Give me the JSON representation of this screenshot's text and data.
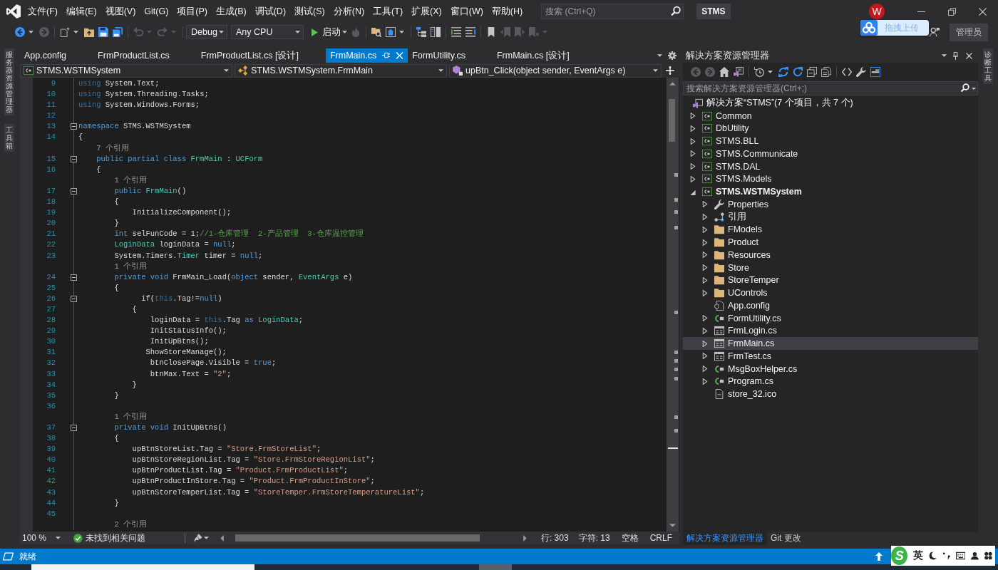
{
  "menu_bar": {
    "items": [
      "文件(F)",
      "编辑(E)",
      "视图(V)",
      "Git(G)",
      "项目(P)",
      "生成(B)",
      "调试(D)",
      "测试(S)",
      "分析(N)",
      "工具(T)",
      "扩展(X)",
      "窗口(W)",
      "帮助(H)"
    ],
    "search": {
      "placeholder": "搜索 (Ctrl+Q)"
    },
    "solution_name": "STMS",
    "account_initial": "W"
  },
  "toolbar": {
    "left_buttons": [
      {
        "kind": "back",
        "disabled": false,
        "dropdown": true
      },
      {
        "kind": "forward",
        "disabled": true,
        "dropdown": false
      },
      {
        "kind": "new",
        "disabled": false,
        "dropdown": true
      },
      {
        "kind": "open",
        "disabled": false,
        "dropdown": false
      },
      {
        "kind": "save",
        "disabled": false,
        "dropdown": false
      },
      {
        "kind": "save-all",
        "disabled": false,
        "dropdown": false
      },
      {
        "kind": "undo",
        "disabled": true,
        "dropdown": true
      },
      {
        "kind": "redo",
        "disabled": true,
        "dropdown": true
      }
    ],
    "configuration": "Debug",
    "platform": "Any CPU",
    "start_label": "启动",
    "right_buttons": [
      {
        "kind": "hot-reload",
        "disabled": true,
        "dropdown": false
      },
      {
        "kind": "find-files",
        "disabled": false,
        "dropdown": false
      },
      {
        "kind": "browser",
        "disabled": false,
        "dropdown": true
      },
      {
        "kind": "hierarchy",
        "disabled": false,
        "dropdown": false
      },
      {
        "kind": "layout",
        "disabled": false,
        "dropdown": false
      },
      {
        "kind": "comment",
        "disabled": false,
        "dropdown": false
      },
      {
        "kind": "uncomment",
        "disabled": false,
        "dropdown": false
      },
      {
        "kind": "bookmark",
        "disabled": false,
        "dropdown": false
      },
      {
        "kind": "bookmark-prev",
        "disabled": true,
        "dropdown": false
      },
      {
        "kind": "bookmark-next",
        "disabled": true,
        "dropdown": false
      },
      {
        "kind": "bookmark-clear",
        "disabled": true,
        "dropdown": true
      }
    ],
    "admin_label": "管理员"
  },
  "upload_widget": {
    "label": "拖拽上传"
  },
  "left_side_tabs": [
    "服务器资源管理器",
    "工具箱"
  ],
  "editor": {
    "tabs": [
      {
        "label": "App.config",
        "selected": false
      },
      {
        "label": "FrmProductList.cs",
        "selected": false
      },
      {
        "label": "FrmProductList.cs [设计]",
        "selected": false
      },
      {
        "label": "FrmMain.cs",
        "selected": true
      },
      {
        "label": "FormUtility.cs",
        "selected": false
      },
      {
        "label": "FrmMain.cs [设计]",
        "selected": false
      }
    ],
    "nav": [
      {
        "kind": "project",
        "label": "STMS.WSTMSystem"
      },
      {
        "kind": "class",
        "label": "STMS.WSTMSystem.FrmMain"
      },
      {
        "kind": "method",
        "label": "upBtn_Click(object sender, EventArgs e)"
      }
    ],
    "lines": [
      {
        "kind": "code",
        "number": "9",
        "collapsible": false,
        "tokens": [
          {
            "kind": "dimmed",
            "text": "using"
          },
          {
            "kind": "plain",
            "text": " System.Text;"
          }
        ]
      },
      {
        "kind": "code",
        "number": "10",
        "collapsible": false,
        "tokens": [
          {
            "kind": "dimmed",
            "text": "using"
          },
          {
            "kind": "plain",
            "text": " System.Threading.Tasks;"
          }
        ]
      },
      {
        "kind": "code",
        "number": "11",
        "collapsible": false,
        "tokens": [
          {
            "kind": "dimmed",
            "text": "using"
          },
          {
            "kind": "plain",
            "text": " System.Windows.Forms;"
          }
        ]
      },
      {
        "kind": "code",
        "number": "12",
        "collapsible": false
      },
      {
        "kind": "code",
        "number": "13",
        "collapsible": true,
        "tokens": [
          {
            "kind": "keyword",
            "text": "namespace"
          },
          {
            "kind": "plain",
            "text": " STMS.WSTMSystem"
          }
        ]
      },
      {
        "kind": "code",
        "number": "14",
        "collapsible": false,
        "tokens": [
          {
            "kind": "plain",
            "text": "{"
          }
        ]
      },
      {
        "kind": "lens",
        "text": "    7 个引用"
      },
      {
        "kind": "code",
        "number": "15",
        "collapsible": true,
        "tokens": [
          {
            "kind": "keyword",
            "text": "    public partial class "
          },
          {
            "kind": "type",
            "text": "FrmMain"
          },
          {
            "kind": "plain",
            "text": " : "
          },
          {
            "kind": "type",
            "text": "UCForm"
          }
        ]
      },
      {
        "kind": "code",
        "number": "16",
        "collapsible": false,
        "tokens": [
          {
            "kind": "plain",
            "text": "    {"
          }
        ]
      },
      {
        "kind": "lens",
        "text": "        1 个引用"
      },
      {
        "kind": "code",
        "number": "17",
        "collapsible": true,
        "tokens": [
          {
            "kind": "keyword",
            "text": "        public "
          },
          {
            "kind": "type",
            "text": "FrmMain"
          },
          {
            "kind": "plain",
            "text": "()"
          }
        ]
      },
      {
        "kind": "code",
        "number": "18",
        "collapsible": false,
        "tokens": [
          {
            "kind": "plain",
            "text": "        {"
          }
        ]
      },
      {
        "kind": "code",
        "number": "19",
        "collapsible": false,
        "tokens": [
          {
            "kind": "plain",
            "text": "            InitializeComponent();"
          }
        ]
      },
      {
        "kind": "code",
        "number": "20",
        "collapsible": false,
        "tokens": [
          {
            "kind": "plain",
            "text": "        }"
          }
        ]
      },
      {
        "kind": "code",
        "number": "21",
        "collapsible": false,
        "tokens": [
          {
            "kind": "keyword",
            "text": "        int"
          },
          {
            "kind": "plain",
            "text": " selFunCode = 1;"
          },
          {
            "kind": "comment",
            "text": "//1-仓库管理  2-产品管理  3-仓库温控管理"
          }
        ]
      },
      {
        "kind": "code",
        "number": "22",
        "collapsible": false,
        "tokens": [
          {
            "kind": "type",
            "text": "        LoginData"
          },
          {
            "kind": "plain",
            "text": " loginData = "
          },
          {
            "kind": "keyword",
            "text": "null"
          },
          {
            "kind": "plain",
            "text": ";"
          }
        ]
      },
      {
        "kind": "code",
        "number": "23",
        "collapsible": false,
        "tokens": [
          {
            "kind": "plain",
            "text": "        System.Timers."
          },
          {
            "kind": "type",
            "text": "Timer"
          },
          {
            "kind": "plain",
            "text": " timer = "
          },
          {
            "kind": "keyword",
            "text": "null"
          },
          {
            "kind": "plain",
            "text": ";"
          }
        ]
      },
      {
        "kind": "lens",
        "text": "        1 个引用"
      },
      {
        "kind": "code",
        "number": "24",
        "collapsible": true,
        "tokens": [
          {
            "kind": "keyword",
            "text": "        private void"
          },
          {
            "kind": "plain",
            "text": " FrmMain_Load("
          },
          {
            "kind": "keyword",
            "text": "object"
          },
          {
            "kind": "plain",
            "text": " sender, "
          },
          {
            "kind": "type",
            "text": "EventArgs"
          },
          {
            "kind": "plain",
            "text": " e)"
          }
        ]
      },
      {
        "kind": "code",
        "number": "25",
        "collapsible": false,
        "tokens": [
          {
            "kind": "plain",
            "text": "        {"
          }
        ]
      },
      {
        "kind": "code",
        "number": "26",
        "collapsible": true,
        "tokens": [
          {
            "kind": "plain",
            "text": "              if("
          },
          {
            "kind": "dimmed",
            "text": "this"
          },
          {
            "kind": "plain",
            "text": ".Tag!="
          },
          {
            "kind": "keyword",
            "text": "null"
          },
          {
            "kind": "plain",
            "text": ")"
          }
        ]
      },
      {
        "kind": "code",
        "number": "27",
        "collapsible": false,
        "tokens": [
          {
            "kind": "plain",
            "text": "            {"
          }
        ]
      },
      {
        "kind": "code",
        "number": "28",
        "collapsible": false,
        "tokens": [
          {
            "kind": "plain",
            "text": "                loginData = "
          },
          {
            "kind": "dimmed",
            "text": "this"
          },
          {
            "kind": "plain",
            "text": ".Tag "
          },
          {
            "kind": "keyword",
            "text": "as "
          },
          {
            "kind": "type",
            "text": "LoginData"
          },
          {
            "kind": "plain",
            "text": ";"
          }
        ]
      },
      {
        "kind": "code",
        "number": "29",
        "collapsible": false,
        "tokens": [
          {
            "kind": "plain",
            "text": "                InitStatusInfo();"
          }
        ]
      },
      {
        "kind": "code",
        "number": "30",
        "collapsible": false,
        "tokens": [
          {
            "kind": "plain",
            "text": "                InitUpBtns();"
          }
        ]
      },
      {
        "kind": "code",
        "number": "31",
        "collapsible": false,
        "tokens": [
          {
            "kind": "plain",
            "text": "               ShowStoreManage();"
          }
        ]
      },
      {
        "kind": "code",
        "number": "32",
        "collapsible": false,
        "tokens": [
          {
            "kind": "plain",
            "text": "                btnClosePage.Visible = "
          },
          {
            "kind": "keyword",
            "text": "true"
          },
          {
            "kind": "plain",
            "text": ";"
          }
        ]
      },
      {
        "kind": "code",
        "number": "33",
        "collapsible": false,
        "tokens": [
          {
            "kind": "plain",
            "text": "                btnMax.Text = "
          },
          {
            "kind": "string",
            "text": "\"2\""
          },
          {
            "kind": "plain",
            "text": ";"
          }
        ]
      },
      {
        "kind": "code",
        "number": "34",
        "collapsible": false,
        "tokens": [
          {
            "kind": "plain",
            "text": "            }"
          }
        ]
      },
      {
        "kind": "code",
        "number": "35",
        "collapsible": false,
        "tokens": [
          {
            "kind": "plain",
            "text": "        }"
          }
        ]
      },
      {
        "kind": "code",
        "number": "36",
        "collapsible": false
      },
      {
        "kind": "lens",
        "text": "        1 个引用"
      },
      {
        "kind": "code",
        "number": "37",
        "collapsible": true,
        "tokens": [
          {
            "kind": "keyword",
            "text": "        private void"
          },
          {
            "kind": "plain",
            "text": " InitUpBtns()"
          }
        ]
      },
      {
        "kind": "code",
        "number": "38",
        "collapsible": false,
        "tokens": [
          {
            "kind": "plain",
            "text": "        {"
          }
        ]
      },
      {
        "kind": "code",
        "number": "39",
        "collapsible": false,
        "tokens": [
          {
            "kind": "plain",
            "text": "            upBtnStoreList.Tag = "
          },
          {
            "kind": "string",
            "text": "\"Store.FrmStoreList\""
          },
          {
            "kind": "plain",
            "text": ";"
          }
        ]
      },
      {
        "kind": "code",
        "number": "40",
        "collapsible": false,
        "tokens": [
          {
            "kind": "plain",
            "text": "            upBtnStoreRegionList.Tag = "
          },
          {
            "kind": "string",
            "text": "\"Store.FrmStoreRegionList\""
          },
          {
            "kind": "plain",
            "text": ";"
          }
        ]
      },
      {
        "kind": "code",
        "number": "41",
        "collapsible": false,
        "tokens": [
          {
            "kind": "plain",
            "text": "            upBtnProductList.Tag = "
          },
          {
            "kind": "string",
            "text": "\"Product.FrmProductList\""
          },
          {
            "kind": "plain",
            "text": ";"
          }
        ]
      },
      {
        "kind": "code",
        "number": "42",
        "collapsible": false,
        "tokens": [
          {
            "kind": "plain",
            "text": "            upBtnProductInStore.Tag = "
          },
          {
            "kind": "string",
            "text": "\"Product.FrmProductInStore\""
          },
          {
            "kind": "plain",
            "text": ";"
          }
        ]
      },
      {
        "kind": "code",
        "number": "43",
        "collapsible": false,
        "tokens": [
          {
            "kind": "plain",
            "text": "            upBtnStoreTemperList.Tag = "
          },
          {
            "kind": "string",
            "text": "\"StoreTemper.FrmStoreTemperatureList\""
          },
          {
            "kind": "plain",
            "text": ";"
          }
        ]
      },
      {
        "kind": "code",
        "number": "44",
        "collapsible": false,
        "tokens": [
          {
            "kind": "plain",
            "text": "        }"
          }
        ]
      },
      {
        "kind": "code",
        "number": "45",
        "collapsible": false
      },
      {
        "kind": "lens",
        "text": "        2 个引用"
      }
    ],
    "zoom": "100 %",
    "issues": "未找到相关问题",
    "position_line": "行: 303",
    "position_char": "字符: 13",
    "indentation": "空格",
    "line_ending": "CRLF"
  },
  "solution_explorer": {
    "title": "解决方案资源管理器",
    "toolbar": [
      {
        "kind": "back",
        "disabled": true,
        "on": false,
        "dropdown": false
      },
      {
        "kind": "forward",
        "disabled": true,
        "on": false,
        "dropdown": false
      },
      {
        "kind": "home",
        "disabled": false,
        "on": false,
        "dropdown": false
      },
      {
        "kind": "switch-views",
        "disabled": false,
        "on": false,
        "dropdown": false
      },
      {
        "kind": "pending-changes",
        "disabled": false,
        "on": false,
        "dropdown": true
      },
      {
        "kind": "sync",
        "disabled": false,
        "on": false,
        "dropdown": false
      },
      {
        "kind": "refresh",
        "disabled": false,
        "on": false,
        "dropdown": false
      },
      {
        "kind": "collapse-all",
        "disabled": false,
        "on": false,
        "dropdown": false
      },
      {
        "kind": "show-all-files",
        "disabled": false,
        "on": false,
        "dropdown": false
      },
      {
        "kind": "view-code",
        "disabled": false,
        "on": false,
        "dropdown": false
      },
      {
        "kind": "properties",
        "disabled": false,
        "on": false,
        "dropdown": false
      },
      {
        "kind": "preview",
        "disabled": false,
        "on": true,
        "dropdown": false
      }
    ],
    "search": {
      "placeholder": "搜索解决方案资源管理器(Ctrl+;)"
    },
    "tree": [
      {
        "kind": "solution",
        "label": "解决方案“STMS”(7 个项目，共 7 个)",
        "selected": false,
        "children": [
          {
            "kind": "project",
            "label": "Common",
            "expanded": false,
            "startup": false,
            "selected": false
          },
          {
            "kind": "project",
            "label": "DbUtility",
            "expanded": false,
            "startup": false,
            "selected": false
          },
          {
            "kind": "project",
            "label": "STMS.BLL",
            "expanded": false,
            "startup": false,
            "selected": false
          },
          {
            "kind": "project",
            "label": "STMS.Communicate",
            "expanded": false,
            "startup": false,
            "selected": false
          },
          {
            "kind": "project",
            "label": "STMS.DAL",
            "expanded": false,
            "startup": false,
            "selected": false
          },
          {
            "kind": "project",
            "label": "STMS.Models",
            "expanded": false,
            "startup": false,
            "selected": false
          },
          {
            "kind": "project",
            "label": "STMS.WSTMSystem",
            "expanded": true,
            "startup": true,
            "selected": false,
            "children": [
              {
                "kind": "properties",
                "label": "Properties",
                "expanded": false,
                "selected": false
              },
              {
                "kind": "references",
                "label": "引用",
                "expanded": false,
                "selected": false
              },
              {
                "kind": "folder",
                "label": "FModels",
                "expanded": false,
                "selected": false
              },
              {
                "kind": "folder",
                "label": "Product",
                "expanded": false,
                "selected": false
              },
              {
                "kind": "folder",
                "label": "Resources",
                "expanded": false,
                "selected": false
              },
              {
                "kind": "folder",
                "label": "Store",
                "expanded": false,
                "selected": false
              },
              {
                "kind": "folder",
                "label": "StoreTemper",
                "expanded": false,
                "selected": false
              },
              {
                "kind": "folder",
                "label": "UControls",
                "expanded": false,
                "selected": false
              },
              {
                "kind": "config",
                "label": "App.config",
                "selected": false
              },
              {
                "kind": "csharp",
                "label": "FormUtility.cs",
                "expanded": false,
                "selected": false
              },
              {
                "kind": "form",
                "label": "FrmLogin.cs",
                "expanded": false,
                "selected": false
              },
              {
                "kind": "form",
                "label": "FrmMain.cs",
                "expanded": false,
                "selected": true
              },
              {
                "kind": "form",
                "label": "FrmTest.cs",
                "expanded": false,
                "selected": false
              },
              {
                "kind": "csharp",
                "label": "MsgBoxHelper.cs",
                "expanded": false,
                "selected": false
              },
              {
                "kind": "csharp",
                "label": "Program.cs",
                "expanded": false,
                "selected": false
              },
              {
                "kind": "file",
                "label": "store_32.ico",
                "selected": false
              }
            ]
          }
        ]
      }
    ],
    "bottom_tabs": [
      {
        "label": "解决方案资源管理器",
        "selected": true
      },
      {
        "label": "Git 更改",
        "selected": false
      }
    ]
  },
  "right_side_tabs": [
    "诊断工具"
  ],
  "status_bar": {
    "message": "就绪"
  },
  "ime_toolbar": {
    "logo_text": "S",
    "mode": "英"
  }
}
